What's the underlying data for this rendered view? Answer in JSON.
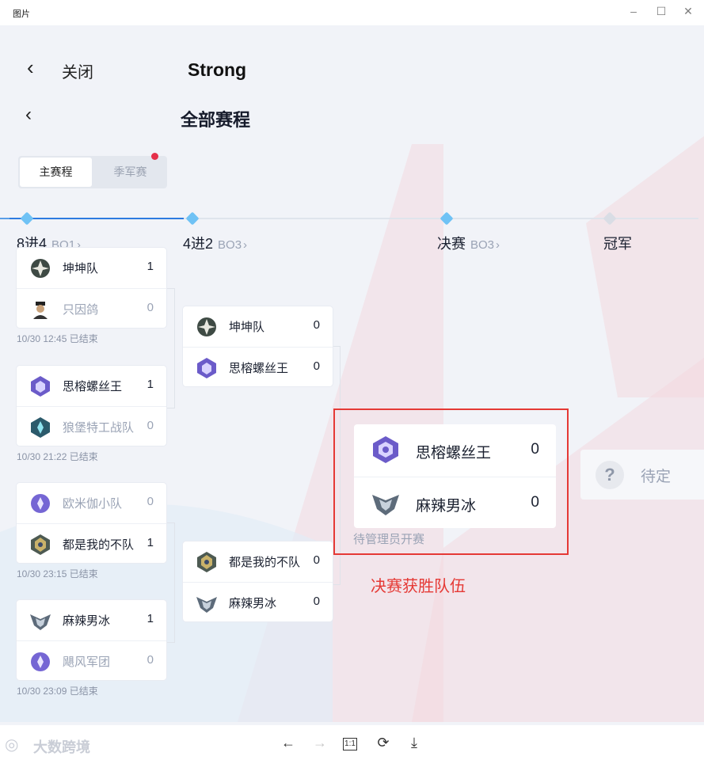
{
  "window": {
    "title": "图片"
  },
  "header": {
    "close_label": "关闭",
    "title": "Strong"
  },
  "page": {
    "title": "全部赛程"
  },
  "segmented": {
    "main_label": "主赛程",
    "third_label": "季军赛"
  },
  "stages": [
    {
      "name": "8进4",
      "bo": "BO1"
    },
    {
      "name": "4进2",
      "bo": "BO3"
    },
    {
      "name": "决赛",
      "bo": "BO3"
    },
    {
      "name": "冠军",
      "bo": ""
    }
  ],
  "round1": [
    {
      "teams": [
        {
          "name": "坤坤队",
          "score": "1"
        },
        {
          "name": "只因鸽",
          "score": "0"
        }
      ],
      "meta": "10/30 12:45 已结束"
    },
    {
      "teams": [
        {
          "name": "思榕螺丝王",
          "score": "1"
        },
        {
          "name": "狼堡特工战队",
          "score": "0"
        }
      ],
      "meta": "10/30 21:22 已结束"
    },
    {
      "teams": [
        {
          "name": "欧米伽小队",
          "score": "0"
        },
        {
          "name": "都是我的不队",
          "score": "1"
        }
      ],
      "meta": "10/30 23:15 已结束"
    },
    {
      "teams": [
        {
          "name": "麻辣男冰",
          "score": "1"
        },
        {
          "name": "飓风军团",
          "score": "0"
        }
      ],
      "meta": "10/30 23:09 已结束"
    }
  ],
  "round2": [
    {
      "teams": [
        {
          "name": "坤坤队",
          "score": "0"
        },
        {
          "name": "思榕螺丝王",
          "score": "0"
        }
      ]
    },
    {
      "teams": [
        {
          "name": "都是我的不队",
          "score": "0"
        },
        {
          "name": "麻辣男冰",
          "score": "0"
        }
      ]
    }
  ],
  "final": {
    "teams": [
      {
        "name": "思榕螺丝王",
        "score": "0"
      },
      {
        "name": "麻辣男冰",
        "score": "0"
      }
    ],
    "meta": "待管理员开赛"
  },
  "champion": {
    "placeholder": "?",
    "label": "待定"
  },
  "annotation": "决赛获胜队伍",
  "watermark": "大数跨境",
  "viewer": {
    "fit_label": "1:1"
  },
  "colors": {
    "accent": "#2d7be0",
    "node": "#6fc2f5",
    "annotation": "#e53935",
    "badge_dot": "#e5304a"
  }
}
